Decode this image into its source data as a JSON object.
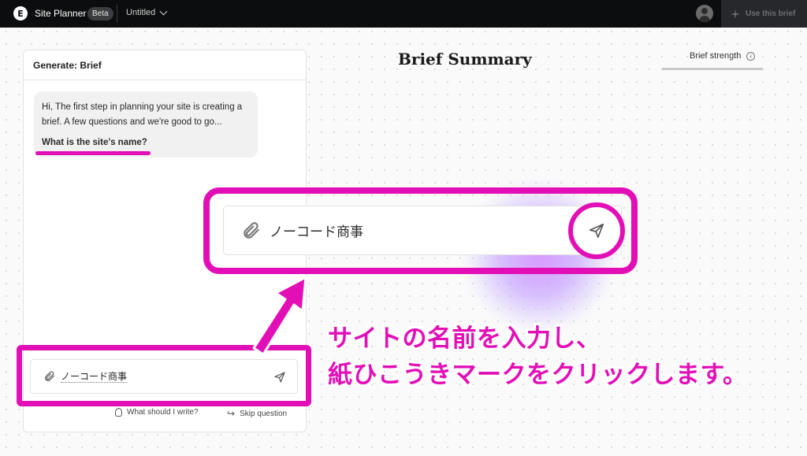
{
  "topbar": {
    "logo_text": "E",
    "app_title": "Site Planner",
    "badge": "Beta",
    "document_title": "Untitled",
    "use_brief_label": "Use this brief"
  },
  "left_panel": {
    "header": "Generate: Brief",
    "message_intro": "Hi, The first step in planning your site is creating a brief. A few questions and we're good to go...",
    "message_question": "What is the site's name?",
    "input_value": "ノーコード商事",
    "hint_write": "What should I write?",
    "hint_skip": "Skip question"
  },
  "summary": {
    "title": "Brief Summary",
    "strength_label": "Brief strength",
    "strength_level": 0.0
  },
  "zoom_callout": {
    "input_value": "ノーコード商事"
  },
  "annotation": {
    "line1": "サイトの名前を入力し、",
    "line2": "紙ひこうきマークをクリックします。"
  },
  "colors": {
    "highlight": "#e20fb7",
    "topbar_bg": "#0c0d0e"
  },
  "icons": [
    "elementor-logo-icon",
    "chevron-down-icon",
    "user-avatar-icon",
    "sparkle-icon",
    "paperclip-icon",
    "send-icon",
    "lightbulb-icon",
    "skip-arrow-icon",
    "info-icon"
  ]
}
